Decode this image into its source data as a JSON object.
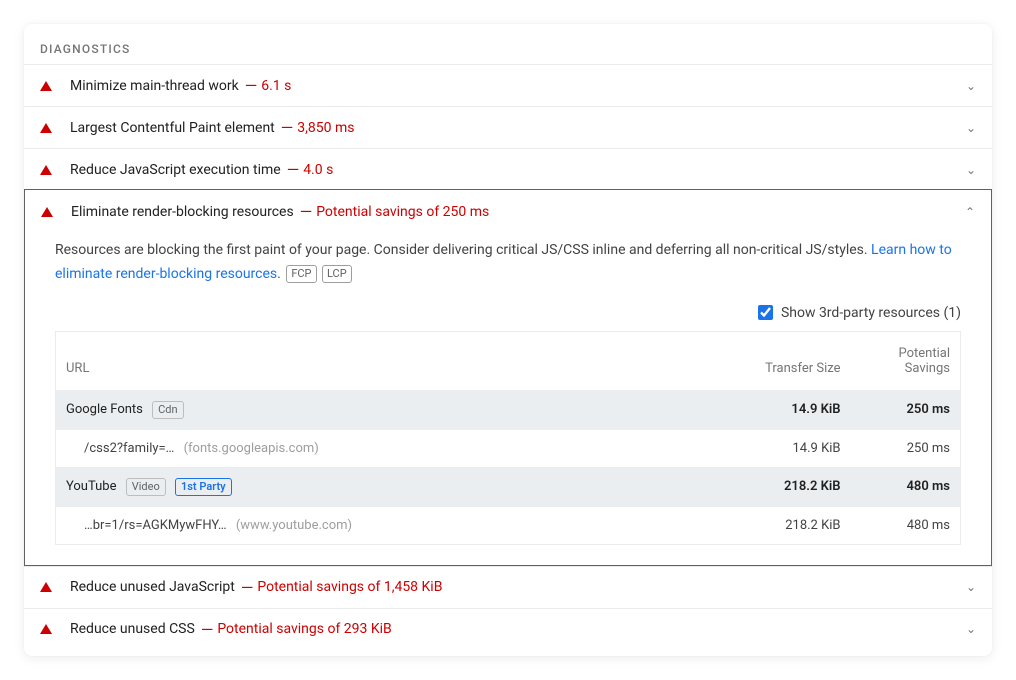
{
  "section_title": "DIAGNOSTICS",
  "audits": {
    "a0": {
      "title": "Minimize main-thread work",
      "metric": "6.1 s"
    },
    "a1": {
      "title": "Largest Contentful Paint element",
      "metric": "3,850 ms"
    },
    "a2": {
      "title": "Reduce JavaScript execution time",
      "metric": "4.0 s"
    },
    "a3": {
      "title": "Eliminate render-blocking resources",
      "metric": "Potential savings of 250 ms"
    },
    "a4": {
      "title": "Reduce unused JavaScript",
      "metric": "Potential savings of 1,458 KiB"
    },
    "a5": {
      "title": "Reduce unused CSS",
      "metric": "Potential savings of 293 KiB"
    }
  },
  "expanded": {
    "desc_pre": "Resources are blocking the first paint of your page. Consider delivering critical JS/CSS inline and deferring all non-critical JS/styles. ",
    "link": "Learn how to eliminate render-blocking resources",
    "desc_post": ". ",
    "badge_fcp": "FCP",
    "badge_lcp": "LCP",
    "show3p_label": "Show 3rd-party resources (1)",
    "col_url": "URL",
    "col_transfer": "Transfer Size",
    "col_savings": "Potential Savings",
    "rows": {
      "g0": {
        "name": "Google Fonts",
        "tag": "Cdn",
        "transfer": "14.9 KiB",
        "savings": "250 ms"
      },
      "r0": {
        "path": "/css2?family=…",
        "host": "(fonts.googleapis.com)",
        "transfer": "14.9 KiB",
        "savings": "250 ms"
      },
      "g1": {
        "name": "YouTube",
        "tag": "Video",
        "tag2": "1st Party",
        "transfer": "218.2 KiB",
        "savings": "480 ms"
      },
      "r1": {
        "path": "…br=1/rs=AGKMywFHY…",
        "host": "(www.youtube.com)",
        "transfer": "218.2 KiB",
        "savings": "480 ms"
      }
    }
  }
}
